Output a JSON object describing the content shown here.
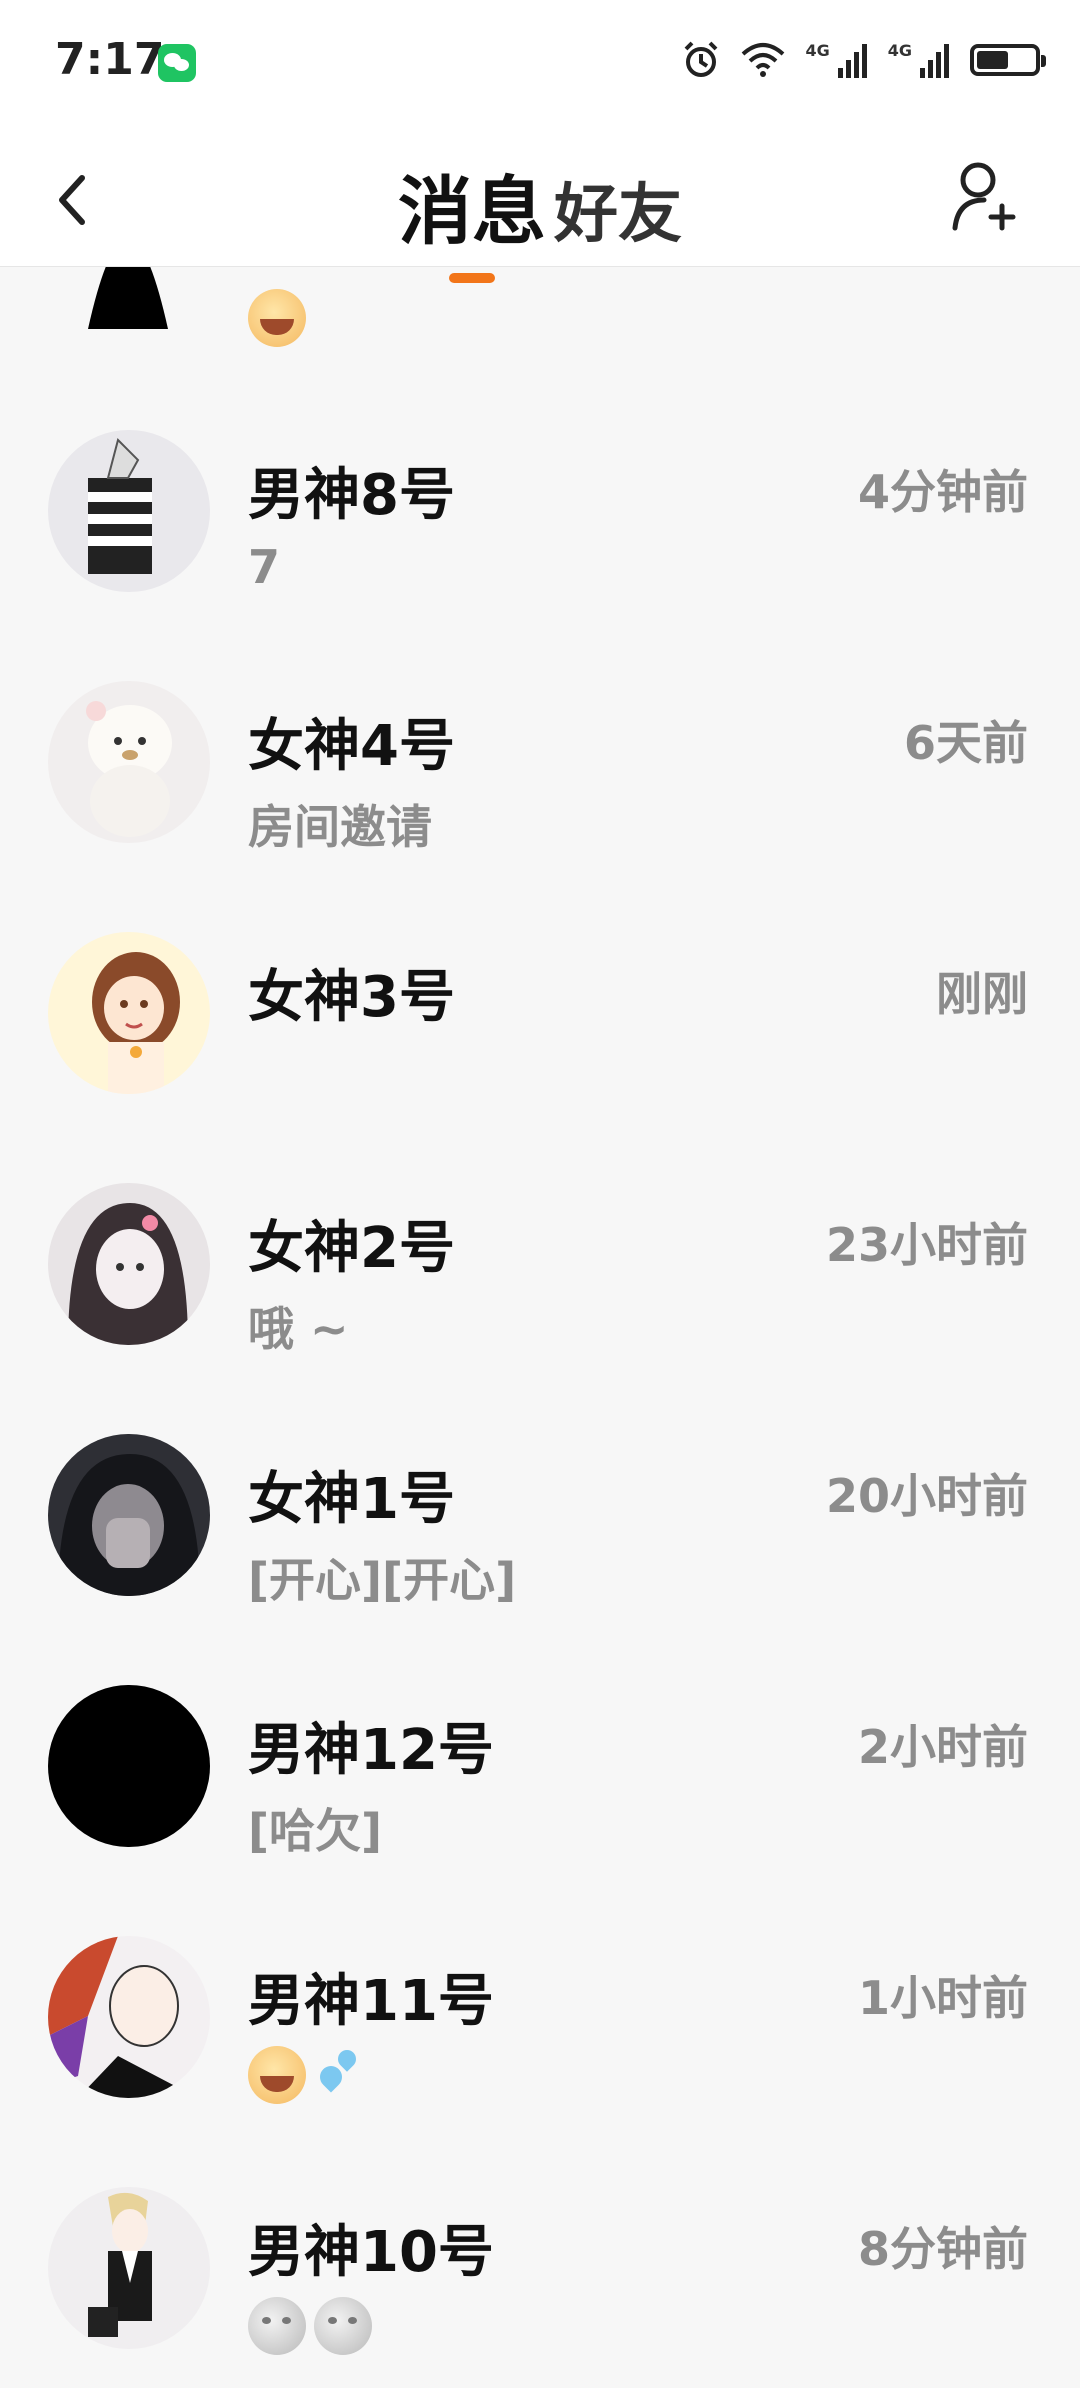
{
  "status_bar": {
    "time": "7:17",
    "network_1": "4G",
    "network_2": "4G",
    "battery_level": 0.55
  },
  "nav": {
    "tab_messages": "消息",
    "tab_friends": "好友",
    "active_tab": "消息"
  },
  "conversations": [
    {
      "name": "",
      "time": "",
      "preview": "",
      "preview_emoji": [
        "grinning-sweat-face"
      ]
    },
    {
      "name": "男神8号",
      "time": "4分钟前",
      "preview": "7"
    },
    {
      "name": "女神4号",
      "time": "6天前",
      "preview": "房间邀请"
    },
    {
      "name": "女神3号",
      "time": "刚刚",
      "preview": ""
    },
    {
      "name": "女神2号",
      "time": "23小时前",
      "preview": "哦 ~"
    },
    {
      "name": "女神1号",
      "time": "20小时前",
      "preview": "[开心][开心]"
    },
    {
      "name": "男神12号",
      "time": "2小时前",
      "preview": "[哈欠]"
    },
    {
      "name": "男神11号",
      "time": "1小时前",
      "preview": "",
      "preview_emoji": [
        "laughing-face",
        "sweat-droplets"
      ]
    },
    {
      "name": "男神10号",
      "time": "8分钟前",
      "preview": "",
      "preview_emoji": [
        "full-moon-face",
        "full-moon-face"
      ]
    }
  ]
}
